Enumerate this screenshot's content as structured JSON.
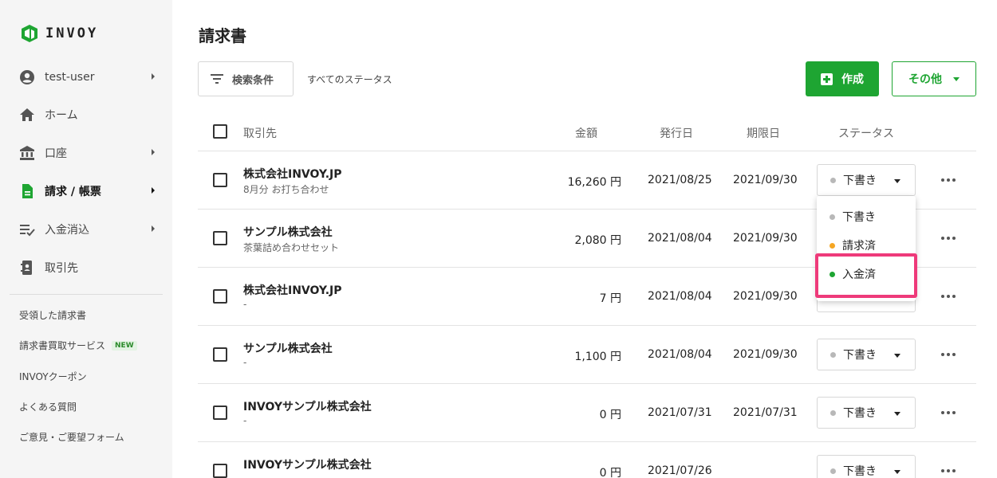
{
  "app": {
    "name": "INVOY"
  },
  "sidebar": {
    "user": {
      "label": "test-user",
      "icon": "account-circle-icon"
    },
    "items": [
      {
        "label": "ホーム",
        "icon": "home-icon"
      },
      {
        "label": "口座",
        "icon": "bank-icon"
      },
      {
        "label": "請求 / 帳票",
        "icon": "document-icon",
        "active": true
      },
      {
        "label": "入金消込",
        "icon": "checklist-icon"
      },
      {
        "label": "取引先",
        "icon": "contact-book-icon"
      }
    ],
    "links": [
      {
        "label": "受領した請求書"
      },
      {
        "label": "請求書買取サービス",
        "badge": "NEW"
      },
      {
        "label": "INVOYクーポン"
      },
      {
        "label": "よくある質問"
      },
      {
        "label": "ご意見・ご要望フォーム"
      }
    ]
  },
  "page": {
    "title": "請求書"
  },
  "toolbar": {
    "filter_label": "検索条件",
    "status_filter": "すべてのステータス",
    "create_label": "作成",
    "other_label": "その他"
  },
  "table": {
    "headers": {
      "client": "取引先",
      "amount": "金額",
      "issue_date": "発行日",
      "due_date": "期限日",
      "status": "ステータス"
    },
    "rows": [
      {
        "client": "株式会社INVOY.JP",
        "memo": "8月分 お打ち合わせ",
        "amount": "16,260 円",
        "issue_date": "2021/08/25",
        "due_date": "2021/09/30",
        "status": "下書き"
      },
      {
        "client": "サンプル株式会社",
        "memo": "茶葉詰め合わせセット",
        "amount": "2,080 円",
        "issue_date": "2021/08/04",
        "due_date": "2021/09/30",
        "status": ""
      },
      {
        "client": "株式会社INVOY.JP",
        "memo": "-",
        "amount": "7 円",
        "issue_date": "2021/08/04",
        "due_date": "2021/09/30",
        "status": ""
      },
      {
        "client": "サンプル株式会社",
        "memo": "-",
        "amount": "1,100 円",
        "issue_date": "2021/08/04",
        "due_date": "2021/09/30",
        "status": "下書き"
      },
      {
        "client": "INVOYサンプル株式会社",
        "memo": "-",
        "amount": "0 円",
        "issue_date": "2021/07/31",
        "due_date": "2021/07/31",
        "status": "下書き"
      },
      {
        "client": "INVOYサンプル株式会社",
        "memo": "",
        "amount": "0 円",
        "issue_date": "2021/07/26",
        "due_date": "",
        "status": "下書き"
      }
    ]
  },
  "status_menu": {
    "items": [
      {
        "label": "下書き",
        "color": "#b8b8b8"
      },
      {
        "label": "請求済",
        "color": "#f5a623"
      },
      {
        "label": "入金済",
        "color": "#1ea532",
        "highlighted": true
      }
    ],
    "highlight_color": "#ee3a7a"
  },
  "colors": {
    "brand": "#1ea532",
    "sidebar_bg": "#f5f5f5"
  }
}
